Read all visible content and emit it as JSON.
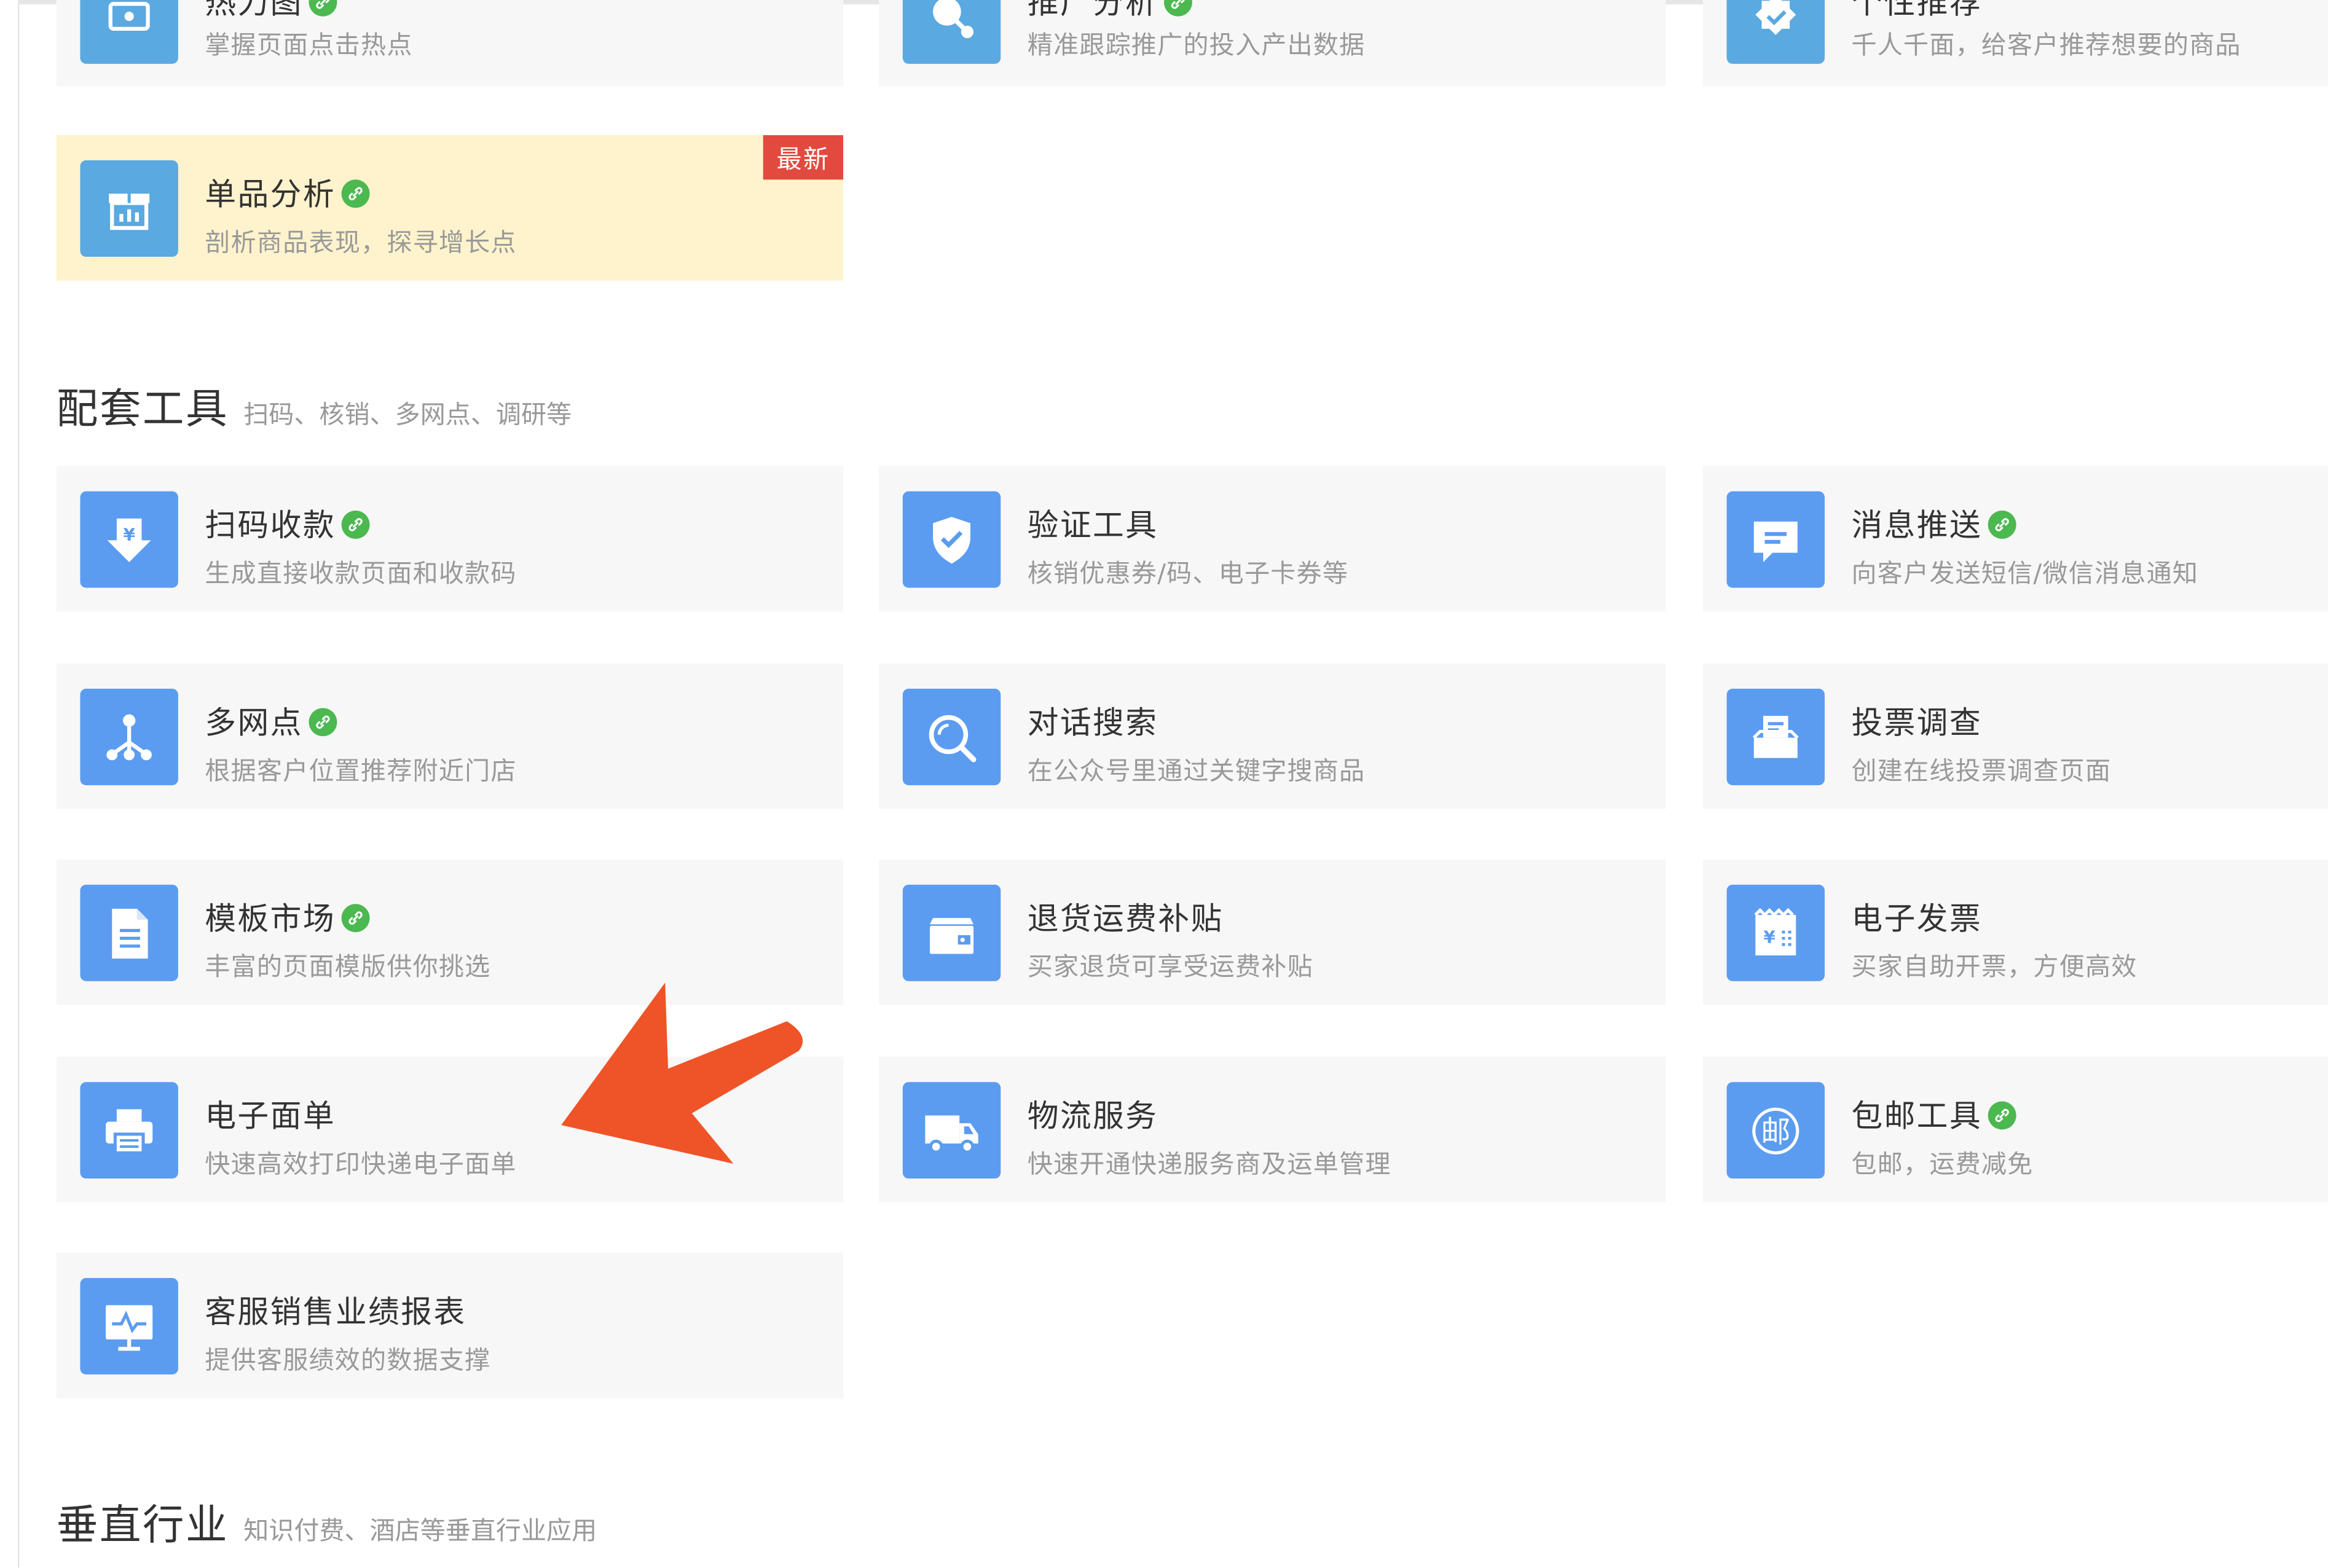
{
  "top_row": [
    {
      "title": "热力图",
      "subtitle": "掌握页面点击热点",
      "icon": "heatmap-icon",
      "has_link": true
    },
    {
      "title": "推广分析",
      "subtitle": "精准跟踪推广的投入产出数据",
      "icon": "promo-analysis-icon",
      "has_link": true
    },
    {
      "title": "个性推荐",
      "subtitle": "千人千面，给客户推荐想要的商品",
      "icon": "award-icon",
      "has_link": false
    }
  ],
  "featured": {
    "title": "单品分析",
    "subtitle": "剖析商品表现，探寻增长点",
    "badge": "最新",
    "icon": "bar-chart-icon",
    "has_link": true
  },
  "section_tools": {
    "heading": "配套工具",
    "desc": "扫码、核销、多网点、调研等"
  },
  "tools": [
    {
      "title": "扫码收款",
      "subtitle": "生成直接收款页面和收款码",
      "icon": "yuan-download-icon",
      "has_link": true
    },
    {
      "title": "验证工具",
      "subtitle": "核销优惠券/码、电子卡券等",
      "icon": "shield-check-icon",
      "has_link": false
    },
    {
      "title": "消息推送",
      "subtitle": "向客户发送短信/微信消息通知",
      "icon": "message-icon",
      "has_link": true
    },
    {
      "title": "多网点",
      "subtitle": "根据客户位置推荐附近门店",
      "icon": "network-nodes-icon",
      "has_link": true
    },
    {
      "title": "对话搜索",
      "subtitle": "在公众号里通过关键字搜商品",
      "icon": "search-icon",
      "has_link": false
    },
    {
      "title": "投票调查",
      "subtitle": "创建在线投票调查页面",
      "icon": "ballot-box-icon",
      "has_link": false
    },
    {
      "title": "模板市场",
      "subtitle": "丰富的页面模版供你挑选",
      "icon": "document-icon",
      "has_link": true
    },
    {
      "title": "退货运费补贴",
      "subtitle": "买家退货可享受运费补贴",
      "icon": "wallet-icon",
      "has_link": false
    },
    {
      "title": "电子发票",
      "subtitle": "买家自助开票，方便高效",
      "icon": "invoice-icon",
      "has_link": false
    },
    {
      "title": "电子面单",
      "subtitle": "快速高效打印快递电子面单",
      "icon": "printer-icon",
      "has_link": false
    },
    {
      "title": "物流服务",
      "subtitle": "快速开通快递服务商及运单管理",
      "icon": "truck-icon",
      "has_link": false
    },
    {
      "title": "包邮工具",
      "subtitle": "包邮，运费减免",
      "icon": "post-icon",
      "icon_text": "邮",
      "has_link": true
    },
    {
      "title": "客服销售业绩报表",
      "subtitle": "提供客服绩效的数据支撑",
      "icon": "monitor-chart-icon",
      "has_link": false
    }
  ],
  "section_vertical": {
    "heading": "垂直行业",
    "desc": "知识付费、酒店等垂直行业应用"
  },
  "colors": {
    "icon_bg": "#5b9cf0",
    "card_bg": "#f7f7f7",
    "featured_bg": "#fff3cd",
    "badge_red": "#e24a3f",
    "link_green": "#4cb850",
    "arrow": "#ee5428"
  }
}
